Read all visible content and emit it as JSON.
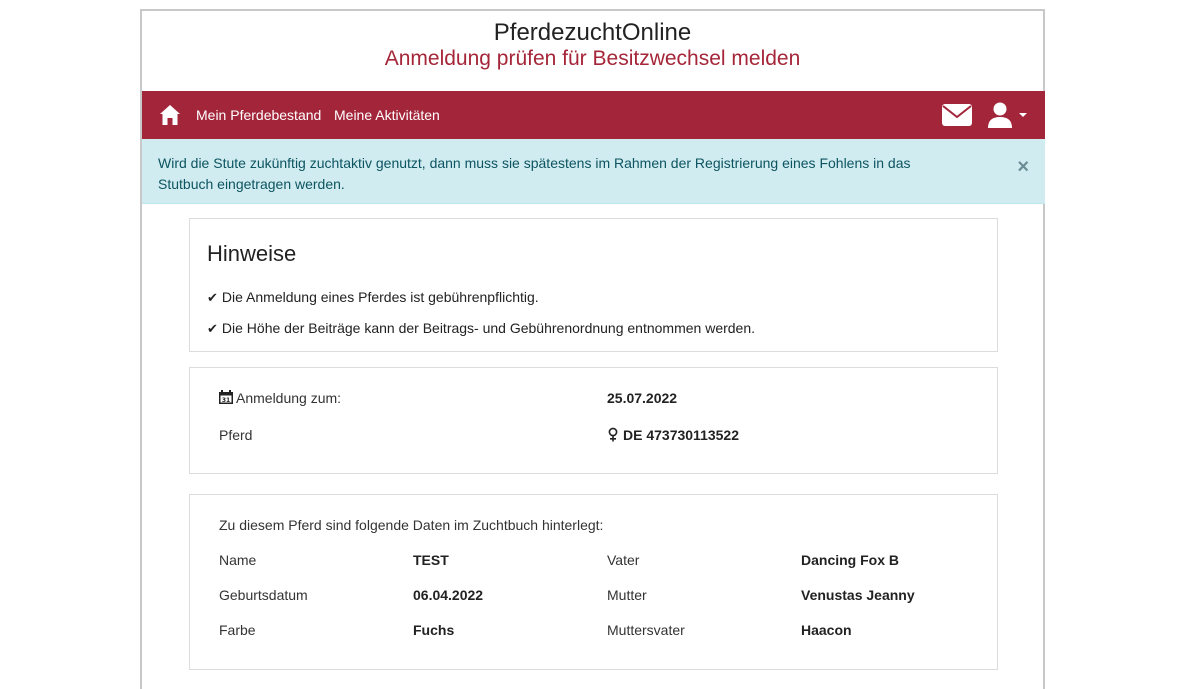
{
  "header": {
    "app_title": "PferdezuchtOnline",
    "subtitle": "Anmeldung prüfen für Besitzwechsel melden"
  },
  "navbar": {
    "home_icon": "home-icon",
    "links": [
      "Mein Pferdebestand",
      "Meine Aktivitäten"
    ],
    "mail_icon": "envelope-icon",
    "user_icon": "user-icon",
    "bg_color": "#a3253a"
  },
  "alert": {
    "text": "Wird die Stute zukünftig zuchtaktiv genutzt, dann muss sie spätestens im Rahmen der Registrierung eines Fohlens in das Stutbuch eingetragen werden.",
    "close": "×"
  },
  "hints": {
    "title": "Hinweise",
    "items": [
      "Die Anmeldung eines Pferdes ist gebührenpflichtig.",
      "Die Höhe der Beiträge kann der Beitrags- und Gebührenordnung entnommen werden."
    ],
    "check_glyph": "✔"
  },
  "registration": {
    "date_label": "Anmeldung zum:",
    "date_value": "25.07.2022",
    "horse_label": "Pferd",
    "horse_value": "DE 473730113522"
  },
  "studbook": {
    "intro": "Zu diesem Pferd sind folgende Daten im Zuchtbuch hinterlegt:",
    "left": [
      {
        "label": "Name",
        "value": "TEST"
      },
      {
        "label": "Geburtsdatum",
        "value": "06.04.2022"
      },
      {
        "label": "Farbe",
        "value": "Fuchs"
      }
    ],
    "right": [
      {
        "label": "Vater",
        "value": "Dancing Fox B"
      },
      {
        "label": "Mutter",
        "value": "Venustas Jeanny"
      },
      {
        "label": "Muttersvater",
        "value": "Haacon"
      }
    ]
  }
}
